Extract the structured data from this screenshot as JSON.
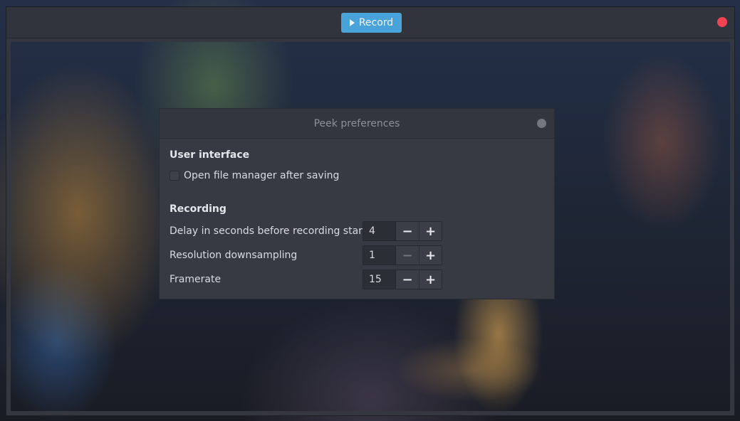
{
  "headerbar": {
    "record_label": "Record"
  },
  "dialog": {
    "title": "Peek preferences",
    "user_interface": {
      "heading": "User interface",
      "open_file_manager_label": "Open file manager after saving",
      "open_file_manager_checked": false
    },
    "recording": {
      "heading": "Recording",
      "rows": [
        {
          "label": "Delay in seconds before recording starts",
          "value": "4",
          "minus_enabled": true
        },
        {
          "label": "Resolution downsampling",
          "value": "1",
          "minus_enabled": false
        },
        {
          "label": "Framerate",
          "value": "15",
          "minus_enabled": true
        }
      ],
      "minus_symbol": "−",
      "plus_symbol": "+"
    }
  },
  "colors": {
    "record_button": "#4aa3d8",
    "close_button": "#f2444f",
    "dialog_bg": "#373a43"
  },
  "icons": {
    "record": "play-icon",
    "close": "close-icon"
  }
}
